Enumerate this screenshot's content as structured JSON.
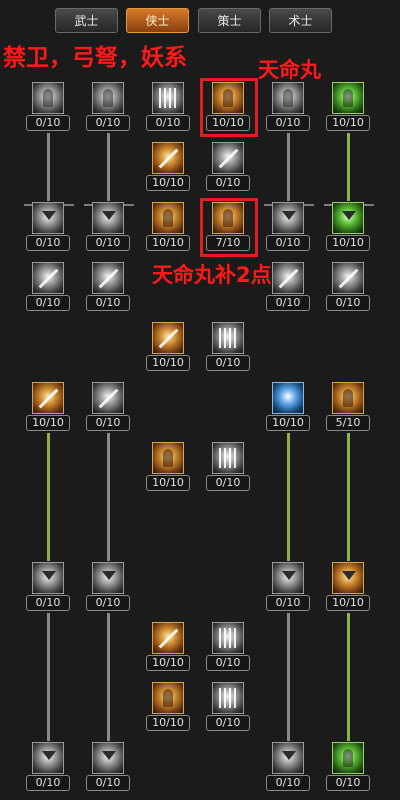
{
  "tabs": [
    {
      "label": "武士",
      "active": false
    },
    {
      "label": "侠士",
      "active": true
    },
    {
      "label": "策士",
      "active": false
    },
    {
      "label": "术士",
      "active": false
    }
  ],
  "annotations": {
    "title": "禁卫，弓弩，妖系",
    "highlight_1": "天命丸",
    "highlight_2": "天命丸补2点"
  },
  "nodes": [
    {
      "count": "0/10",
      "icon": "figure-grey-icon"
    },
    {
      "count": "0/10",
      "icon": "figure-grey-icon"
    },
    {
      "count": "0/10",
      "icon": "light-burst-icon"
    },
    {
      "count": "10/10",
      "icon": "tianming-pill-figure-icon"
    },
    {
      "count": "0/10",
      "icon": "figure-grey-icon"
    },
    {
      "count": "10/10",
      "icon": "figure-green-icon"
    },
    {
      "count": "10/10",
      "icon": "scroll-arrow-icon"
    },
    {
      "count": "0/10",
      "icon": "crossed-blades-icon"
    },
    {
      "count": "0/10",
      "icon": "arrow-down-icon"
    },
    {
      "count": "0/10",
      "icon": "arrow-down-icon"
    },
    {
      "count": "10/10",
      "icon": "flame-figure-icon"
    },
    {
      "count": "7/10",
      "icon": "meditating-figure-icon"
    },
    {
      "count": "0/10",
      "icon": "arrow-down-icon"
    },
    {
      "count": "10/10",
      "icon": "arrow-down-green-icon"
    },
    {
      "count": "0/10",
      "icon": "sword-icon"
    },
    {
      "count": "0/10",
      "icon": "sword-icon"
    },
    {
      "count": "0/10",
      "icon": "sword-icon"
    },
    {
      "count": "0/10",
      "icon": "sword-icon"
    },
    {
      "count": "10/10",
      "icon": "scroll-icon"
    },
    {
      "count": "0/10",
      "icon": "light-pillar-icon"
    },
    {
      "count": "10/10",
      "icon": "spear-icon"
    },
    {
      "count": "0/10",
      "icon": "crossbow-icon"
    },
    {
      "count": "10/10",
      "icon": "chain-lightning-icon"
    },
    {
      "count": "5/10",
      "icon": "demon-figure-icon"
    },
    {
      "count": "10/10",
      "icon": "golden-figure-icon"
    },
    {
      "count": "0/10",
      "icon": "arrow-rain-icon"
    },
    {
      "count": "0/10",
      "icon": "arrow-down-icon"
    },
    {
      "count": "0/10",
      "icon": "arrow-down-icon"
    },
    {
      "count": "0/10",
      "icon": "arrow-down-icon"
    },
    {
      "count": "10/10",
      "icon": "arrow-down-gold-icon"
    },
    {
      "count": "10/10",
      "icon": "flame-spear-icon"
    },
    {
      "count": "0/10",
      "icon": "chain-icon"
    },
    {
      "count": "10/10",
      "icon": "flame-figure-icon"
    },
    {
      "count": "0/10",
      "icon": "cage-icon"
    },
    {
      "count": "0/10",
      "icon": "arrow-down-icon"
    },
    {
      "count": "0/10",
      "icon": "arrow-down-icon"
    },
    {
      "count": "0/10",
      "icon": "arrow-down-icon"
    },
    {
      "count": "0/10",
      "icon": "demon-green-icon"
    }
  ],
  "colors": {
    "background": "#1b1b1b",
    "active_tab": "#d67a2a",
    "annotation": "#ff1a1a",
    "learned_line": "#8db43a",
    "unlearned_line": "#8a8a8a"
  }
}
